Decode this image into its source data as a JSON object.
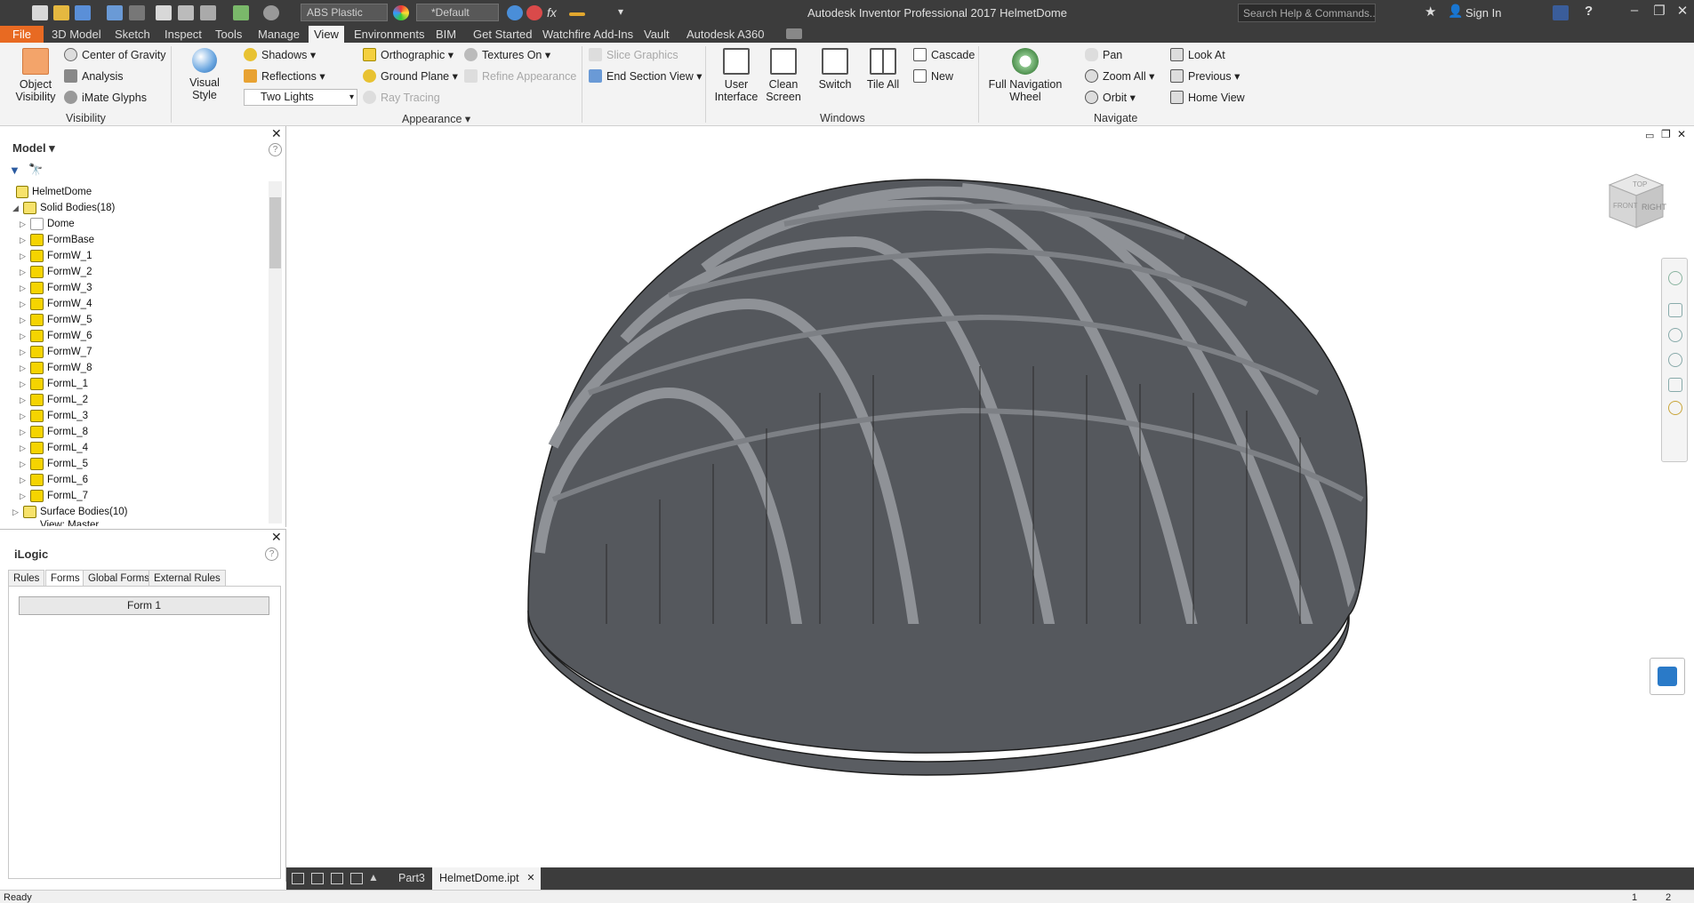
{
  "titlebar": {
    "material": "ABS Plastic",
    "appearance": "*Default",
    "title": "Autodesk Inventor Professional 2017   HelmetDome",
    "search_placeholder": "Search Help & Commands...",
    "sign_in": "Sign In",
    "minimize": "–",
    "restore": "❐",
    "close": "✕",
    "help": "?"
  },
  "tabs": [
    "File",
    "3D Model",
    "Sketch",
    "Inspect",
    "Tools",
    "Manage",
    "View",
    "Environments",
    "BIM",
    "Get Started",
    "Watchfire Add-Ins",
    "Vault",
    "Autodesk A360"
  ],
  "active_tab": "View",
  "ribbon": {
    "visibility": {
      "object_visibility": "Object\nVisibility",
      "center_of_gravity": "Center of Gravity",
      "analysis": "Analysis",
      "imate_glyphs": "iMate Glyphs",
      "label": "Visibility"
    },
    "appearance": {
      "visual_style": "Visual Style",
      "shadows": "Shadows",
      "reflections": "Reflections",
      "lighting": "Two Lights",
      "orthographic": "Orthographic",
      "ground_plane": "Ground Plane",
      "ray_tracing": "Ray Tracing",
      "textures_on": "Textures On",
      "refine_appearance": "Refine Appearance",
      "slice_graphics": "Slice Graphics",
      "end_section_view": "End Section View",
      "label": "Appearance"
    },
    "windows": {
      "user_interface": "User\nInterface",
      "clean_screen": "Clean\nScreen",
      "switch": "Switch",
      "tile_all": "Tile All",
      "cascade": "Cascade",
      "new": "New",
      "label": "Windows"
    },
    "navigate": {
      "full_nav_wheel": "Full Navigation\nWheel",
      "pan": "Pan",
      "zoom_all": "Zoom All",
      "orbit": "Orbit",
      "look_at": "Look At",
      "previous": "Previous",
      "home_view": "Home View",
      "label": "Navigate"
    }
  },
  "browser": {
    "title": "Model",
    "root": "HelmetDome",
    "solid_bodies": "Solid Bodies(18)",
    "items": [
      "Dome",
      "FormBase",
      "FormW_1",
      "FormW_2",
      "FormW_3",
      "FormW_4",
      "FormW_5",
      "FormW_6",
      "FormW_7",
      "FormW_8",
      "FormL_1",
      "FormL_2",
      "FormL_3",
      "FormL_8",
      "FormL_4",
      "FormL_5",
      "FormL_6",
      "FormL_7"
    ],
    "surface_bodies": "Surface Bodies(10)",
    "view_master": "View: Master"
  },
  "ilogic": {
    "title": "iLogic",
    "tabs": [
      "Rules",
      "Forms",
      "Global Forms",
      "External Rules"
    ],
    "active_tab": "Forms",
    "form_button": "Form 1"
  },
  "viewcube": {
    "top": "TOP",
    "front": "FRONT",
    "right": "RIGHT"
  },
  "doc_tabs": [
    "Part3",
    "HelmetDome.ipt"
  ],
  "status": {
    "text": "Ready",
    "page1": "1",
    "page2": "2"
  }
}
